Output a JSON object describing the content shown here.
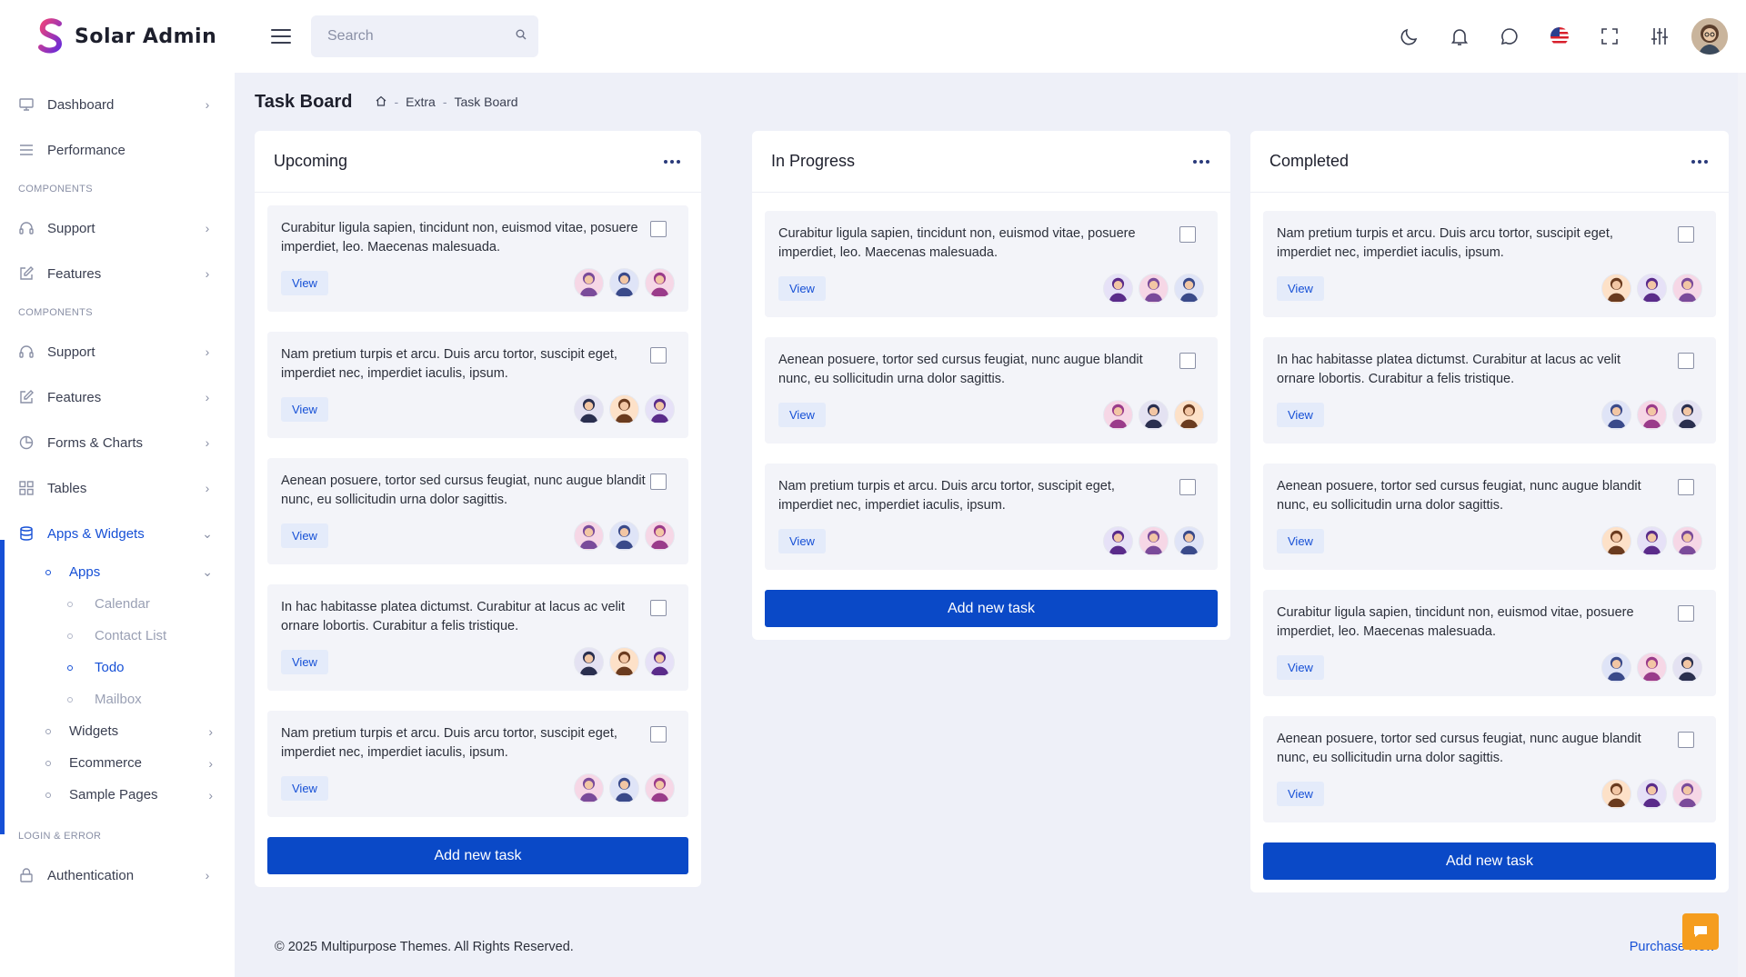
{
  "app": {
    "name": "Solar Admin"
  },
  "search": {
    "placeholder": "Search"
  },
  "sidebar": {
    "items_top": [
      {
        "label": "Dashboard",
        "icon": "monitor-icon"
      },
      {
        "label": "Performance",
        "icon": "list-icon"
      }
    ],
    "section1": "COMPONENTS",
    "items_mid1": [
      {
        "label": "Support",
        "icon": "headset-icon"
      },
      {
        "label": "Features",
        "icon": "edit-icon"
      }
    ],
    "section2": "COMPONENTS",
    "items_mid2": [
      {
        "label": "Support",
        "icon": "headset-icon"
      },
      {
        "label": "Features",
        "icon": "edit-icon"
      },
      {
        "label": "Forms & Charts",
        "icon": "pie-chart-icon"
      },
      {
        "label": "Tables",
        "icon": "grid-icon"
      },
      {
        "label": "Apps & Widgets",
        "icon": "database-icon"
      }
    ],
    "apps": {
      "label": "Apps",
      "children": [
        "Calendar",
        "Contact List",
        "Todo",
        "Mailbox"
      ]
    },
    "sub_items": [
      "Widgets",
      "Ecommerce",
      "Sample Pages"
    ],
    "section3": "LOGIN & ERROR",
    "items_bottom": [
      {
        "label": "Authentication",
        "icon": "lock-icon"
      }
    ]
  },
  "page": {
    "title": "Task Board",
    "breadcrumb": [
      "Extra",
      "Task Board"
    ]
  },
  "board": {
    "add_label": "Add new task",
    "view_label": "View",
    "columns": [
      {
        "title": "Upcoming",
        "tasks": [
          "Curabitur ligula sapien, tincidunt non, euismod vitae, posuere imperdiet, leo. Maecenas malesuada.",
          "Nam pretium turpis et arcu. Duis arcu tortor, suscipit eget, imperdiet nec, imperdiet iaculis, ipsum.",
          "Aenean posuere, tortor sed cursus feugiat, nunc augue blandit nunc, eu sollicitudin urna dolor sagittis.",
          "In hac habitasse platea dictumst. Curabitur at lacus ac velit ornare lobortis. Curabitur a felis tristique.",
          "Nam pretium turpis et arcu. Duis arcu tortor, suscipit eget, imperdiet nec, imperdiet iaculis, ipsum."
        ]
      },
      {
        "title": "In Progress",
        "tasks": [
          "Curabitur ligula sapien, tincidunt non, euismod vitae, posuere imperdiet, leo. Maecenas malesuada.",
          "Aenean posuere, tortor sed cursus feugiat, nunc augue blandit nunc, eu sollicitudin urna dolor sagittis.",
          "Nam pretium turpis et arcu. Duis arcu tortor, suscipit eget, imperdiet nec, imperdiet iaculis, ipsum."
        ]
      },
      {
        "title": "Completed",
        "tasks": [
          "Nam pretium turpis et arcu. Duis arcu tortor, suscipit eget, imperdiet nec, imperdiet iaculis, ipsum.",
          "In hac habitasse platea dictumst. Curabitur at lacus ac velit ornare lobortis. Curabitur a felis tristique.",
          "Aenean posuere, tortor sed cursus feugiat, nunc augue blandit nunc, eu sollicitudin urna dolor sagittis.",
          "Curabitur ligula sapien, tincidunt non, euismod vitae, posuere imperdiet, leo. Maecenas malesuada.",
          "Aenean posuere, tortor sed cursus feugiat, nunc augue blandit nunc, eu sollicitudin urna dolor sagittis."
        ]
      }
    ]
  },
  "footer": {
    "prefix": "© 2025 ",
    "brand": "Multipurpose Themes",
    "suffix": ". All Rights Reserved.",
    "purchase": "Purchase Now"
  },
  "colors": {
    "primary": "#0a49c7",
    "accent": "#1650d6",
    "fab": "#f59d1e"
  }
}
